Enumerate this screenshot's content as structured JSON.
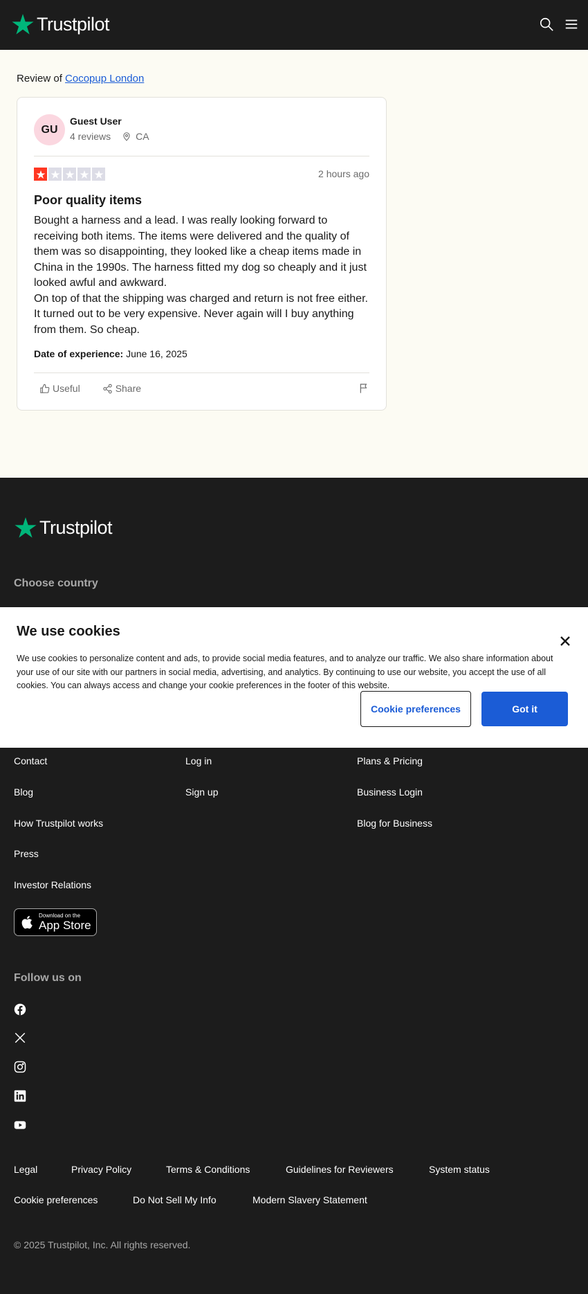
{
  "header": {
    "logo_text": "Trustpilot",
    "search_icon": "search-icon",
    "menu_icon": "hamburger-menu-icon"
  },
  "colors": {
    "brand_green": "#00b67a",
    "star_red": "#ff3722",
    "star_empty": "#dcdce6",
    "link_blue": "#1b5cd6",
    "dark_bg": "#1c1c1c",
    "page_bg": "#fcfbf3"
  },
  "review_of": {
    "prefix": "Review of",
    "company": "Cocopup London"
  },
  "review": {
    "avatar_initials": "GU",
    "user_name": "Guest User",
    "review_count": "4 reviews",
    "location": "CA",
    "rating": 1,
    "max_rating": 5,
    "time": "2 hours ago",
    "title": "Poor quality items",
    "body_p1": "Bought a harness and a lead. I was really looking forward to receiving both items. The items were delivered and the quality of them was so disappointing, they looked like a cheap items made in China in the 1990s. The harness fitted my dog so cheaply and it just looked awful and awkward.",
    "body_p2": "On top of that the shipping was charged and return is not free either. It turned out to be very expensive. Never again will I buy anything from them. So cheap.",
    "date_label": "Date of experience:",
    "date_value": "June 16, 2025",
    "useful_label": "Useful",
    "share_label": "Share"
  },
  "footer": {
    "logo_text": "Trustpilot",
    "choose_country": "Choose country",
    "col1": [
      "Contact",
      "Blog",
      "How Trustpilot works",
      "Press",
      "Investor Relations"
    ],
    "col2": [
      "Log in",
      "Sign up"
    ],
    "col3": [
      "Plans & Pricing",
      "Business Login",
      "Blog for Business"
    ],
    "appstore_line1": "Download on the",
    "appstore_line2": "App Store",
    "follow_us": "Follow us on",
    "social": [
      "facebook-icon",
      "x-icon",
      "instagram-icon",
      "linkedin-icon",
      "youtube-icon"
    ],
    "legal_row1": [
      "Legal",
      "Privacy Policy",
      "Terms & Conditions",
      "Guidelines for Reviewers",
      "System status"
    ],
    "legal_row2": [
      "Cookie preferences",
      "Do Not Sell My Info",
      "Modern Slavery Statement"
    ],
    "copyright": "© 2025 Trustpilot, Inc. All rights reserved."
  },
  "cookie_banner": {
    "title": "We use cookies",
    "text": "We use cookies to personalize content and ads, to provide social media features, and to analyze our traffic. We also share information about your use of our site with our partners in social media, advertising, and analytics. By continuing to use our website, you accept the use of all cookies. You can always access and change your cookie preferences in the footer of this website.",
    "preferences_button": "Cookie preferences",
    "accept_button": "Got it"
  }
}
